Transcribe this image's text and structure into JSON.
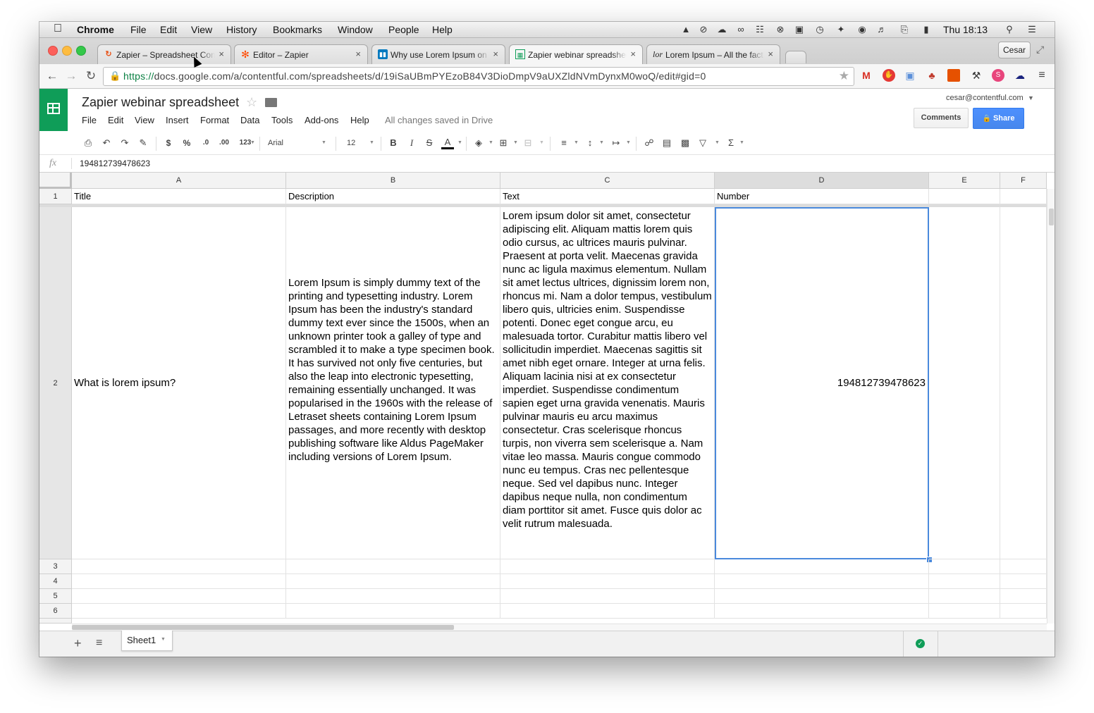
{
  "os_menubar": {
    "app_name": "Chrome",
    "items": [
      "File",
      "Edit",
      "View",
      "History",
      "Bookmarks",
      "Window",
      "People",
      "Help"
    ],
    "clock": "Thu 18:13"
  },
  "browser": {
    "tabs": [
      {
        "title": "Zapier – Spreadsheet Cont",
        "icon": "zapier-icon"
      },
      {
        "title": "Editor – Zapier",
        "icon": "zapier-editor-icon"
      },
      {
        "title": "Why use Lorem Ipsum on C",
        "icon": "trello-icon"
      },
      {
        "title": "Zapier webinar spreadshee",
        "icon": "sheets-icon"
      },
      {
        "title": "Lorem Ipsum – All the fact",
        "icon": "lorem-icon"
      }
    ],
    "active_tab": 3,
    "profile": "Cesar",
    "url_https": "https://",
    "url_rest": "docs.google.com/a/contentful.com/spreadsheets/d/19iSaUBmPYEzoB84V3DioDmpV9aUXZldNVmDynxM0woQ/edit#gid=0"
  },
  "sheets": {
    "doc_title": "Zapier webinar spreadsheet",
    "menu": [
      "File",
      "Edit",
      "View",
      "Insert",
      "Format",
      "Data",
      "Tools",
      "Add-ons",
      "Help"
    ],
    "save_status": "All changes saved in Drive",
    "account": "cesar@contentful.com",
    "comments_label": "Comments",
    "share_label": "Share",
    "toolbar": {
      "currency": "$",
      "percent": "%",
      "dec_decrease": ".0",
      "dec_increase": ".00",
      "more_formats": "123",
      "font": "Arial",
      "font_size": "12",
      "bold": "B",
      "italic": "I",
      "strike": "S",
      "text_color": "A",
      "sum": "Σ"
    },
    "fx_label": "fx",
    "formula_value": "194812739478623",
    "columns": [
      "A",
      "B",
      "C",
      "D",
      "E",
      "F"
    ],
    "selected_column": "D",
    "rows": [
      {
        "num": "1",
        "A": "Title",
        "B": "Description",
        "C": "Text",
        "D": "Number"
      },
      {
        "num": "2",
        "A": "What is lorem ipsum?",
        "B": "Lorem Ipsum is simply dummy text of the printing and typesetting industry. Lorem Ipsum has been the industry's standard dummy text ever since the 1500s, when an unknown printer took a galley of type and scrambled it to make a type specimen book. It has survived not only five centuries, but also the leap into electronic typesetting, remaining essentially unchanged. It was popularised in the 1960s with the release of Letraset sheets containing Lorem Ipsum passages, and more recently with desktop publishing software like Aldus PageMaker including versions of Lorem Ipsum.",
        "C": "Lorem ipsum dolor sit amet, consectetur adipiscing elit. Aliquam mattis lorem quis odio cursus, ac ultrices mauris pulvinar. Praesent at porta velit. Maecenas gravida nunc ac ligula maximus elementum. Nullam sit amet lectus ultrices, dignissim lorem non, rhoncus mi. Nam a dolor tempus, vestibulum libero quis, ultricies enim. Suspendisse potenti. Donec eget congue arcu, eu malesuada tortor. Curabitur mattis libero vel sollicitudin imperdiet. Maecenas sagittis sit amet nibh eget ornare. Integer at urna felis. Aliquam lacinia nisi at ex consectetur imperdiet. Suspendisse condimentum sapien eget urna gravida venenatis. Mauris pulvinar mauris eu arcu maximus consectetur. Cras scelerisque rhoncus turpis, non viverra sem scelerisque a. Nam vitae leo massa. Mauris congue commodo nunc eu tempus. Cras nec pellentesque neque. Sed vel dapibus nunc. Integer dapibus neque nulla, non condimentum diam porttitor sit amet. Fusce quis dolor ac velit rutrum malesuada.",
        "D": "194812739478623"
      },
      {
        "num": "3",
        "A": "",
        "B": "",
        "C": "",
        "D": ""
      },
      {
        "num": "4",
        "A": "",
        "B": "",
        "C": "",
        "D": ""
      },
      {
        "num": "5",
        "A": "",
        "B": "",
        "C": "",
        "D": ""
      },
      {
        "num": "6",
        "A": "",
        "B": "",
        "C": "",
        "D": ""
      }
    ],
    "sheet_tab": "Sheet1",
    "colors": {
      "accent": "#4d90fe",
      "sheets_green": "#0f9d58",
      "selection": "#4a89dc"
    }
  }
}
